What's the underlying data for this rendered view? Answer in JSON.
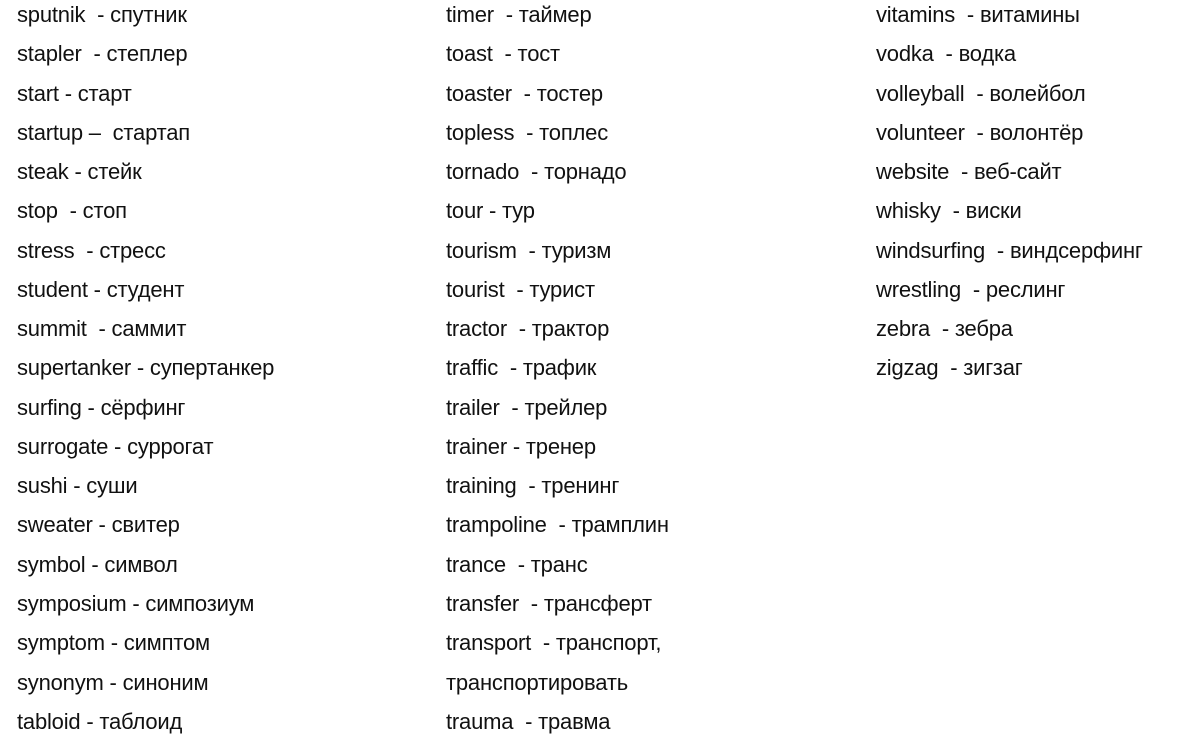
{
  "document": {
    "columns": [
      {
        "lines": [
          "sputnik  - спутник",
          "stapler  - степлер",
          "start - старт",
          "startup –  стартап",
          "steak - стейк",
          "stop  - стоп",
          "stress  - стресс",
          "student - студент",
          "summit  - саммит",
          "supertanker - супертанкер",
          "surfing - сёрфинг",
          "surrogate - суррогат",
          "sushi - суши",
          "sweater - свитер",
          "symbol - символ",
          "symposium - симпозиум",
          "symptom - симптом",
          "synonym - синоним",
          "tabloid - таблоид"
        ]
      },
      {
        "lines": [
          "timer  - таймер",
          "toast  - тост",
          "toaster  - тостер",
          "topless  - топлес",
          "tornado  - торнадо",
          "tour - тур",
          "tourism  - туризм",
          "tourist  - турист",
          "tractor  - трактор",
          "traffic  - трафик",
          "trailer  - трейлер",
          "trainer - тренер",
          "training  - тренинг",
          "trampoline  - трамплин",
          "trance  - транс",
          "transfer  - трансферт",
          "transport  - транспорт,",
          "транспортировать",
          "trauma  - травма"
        ]
      },
      {
        "lines": [
          "vitamins  - витамины",
          "vodka  - водка",
          "volleyball  - волейбол",
          "volunteer  - волонтёр",
          "website  - веб-сайт",
          "whisky  - виски",
          "windsurfing  - виндсерфинг",
          "wrestling  - реслинг",
          "zebra  - зебра",
          "zigzag  - зигзаг"
        ]
      }
    ]
  }
}
